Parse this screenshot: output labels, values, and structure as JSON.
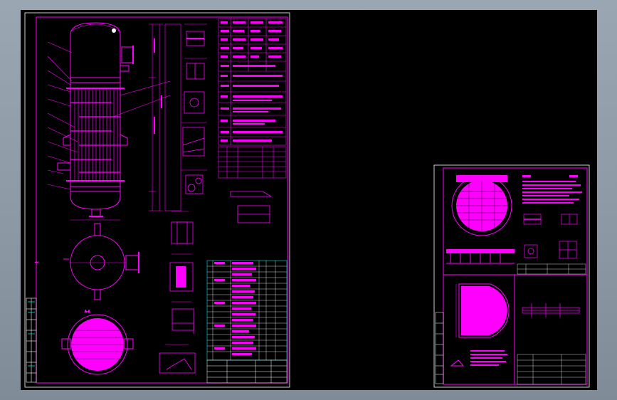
{
  "app": {
    "title": "",
    "accent_color": "#ff00ff",
    "background_color": "#000000",
    "frame_color": "#8e9aa6"
  },
  "sheets": [
    {
      "id": "sheet-1",
      "title_block": {
        "drawing_name": "",
        "drawing_no": "",
        "scale": ""
      },
      "views": {
        "main_view_label": "",
        "section_label": "A—A",
        "note": ""
      }
    },
    {
      "id": "sheet-2",
      "title_block": {
        "drawing_name": "",
        "drawing_no": "",
        "scale": ""
      }
    }
  ]
}
